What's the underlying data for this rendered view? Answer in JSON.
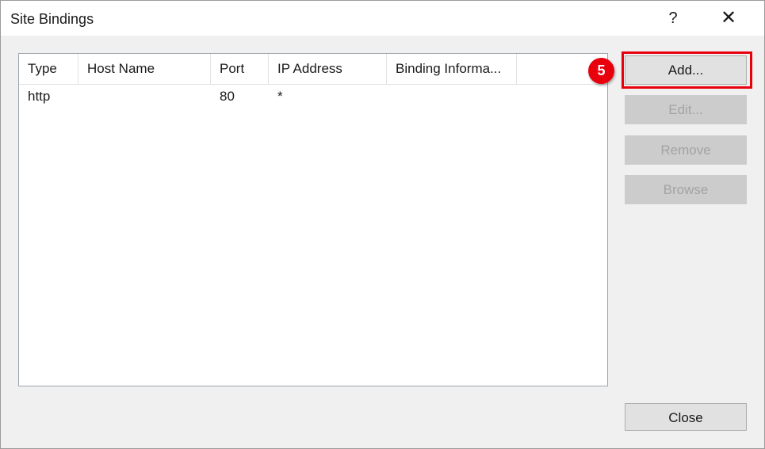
{
  "window": {
    "title": "Site Bindings",
    "help_glyph": "?",
    "close_glyph": "✕",
    "accent_color": "#e8000d",
    "body_background": "#f0f0f0",
    "titlebar_background": "#ffffff"
  },
  "listview": {
    "columns": [
      {
        "label": "Type"
      },
      {
        "label": "Host Name"
      },
      {
        "label": "Port"
      },
      {
        "label": "IP Address"
      },
      {
        "label": "Binding Informa..."
      }
    ],
    "rows": [
      {
        "type": "http",
        "host_name": "",
        "port": "80",
        "ip_address": "*",
        "binding_information": ""
      }
    ]
  },
  "buttons": {
    "add": {
      "label": "Add...",
      "enabled": true
    },
    "edit": {
      "label": "Edit...",
      "enabled": false
    },
    "remove": {
      "label": "Remove",
      "enabled": false
    },
    "browse": {
      "label": "Browse",
      "enabled": false
    },
    "close": {
      "label": "Close",
      "enabled": true
    }
  },
  "annotation": {
    "step_number": "5",
    "target": "add-button"
  }
}
